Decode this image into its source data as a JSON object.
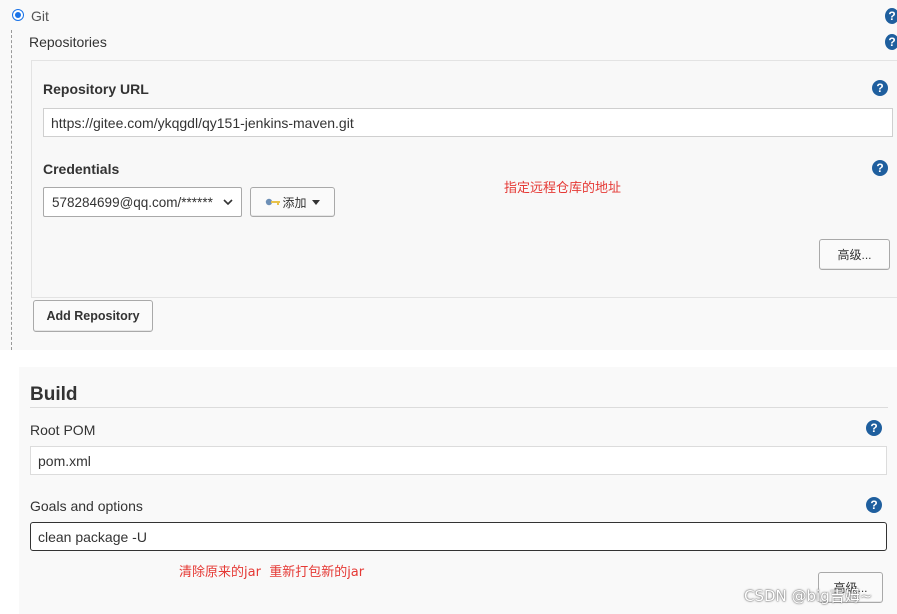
{
  "scm": {
    "option_label": "Git",
    "repositories_label": "Repositories",
    "repository_url_label": "Repository URL",
    "repository_url_value": "https://gitee.com/ykqgdl/qy151-jenkins-maven.git",
    "credentials_label": "Credentials",
    "credentials_value": "578284699@qq.com/******",
    "add_credential_label": "添加",
    "advanced_label": "高级...",
    "add_repository_label": "Add Repository",
    "annotation": "指定远程仓库的地址",
    "help_glyph": "?"
  },
  "build": {
    "title": "Build",
    "root_pom_label": "Root POM",
    "root_pom_value": "pom.xml",
    "goals_label": "Goals and options",
    "goals_value": "clean package -U",
    "annotation": "清除原来的jar  重新打包新的jar",
    "advanced_label": "高级..."
  },
  "watermark": "CSDN @big吉姆~",
  "colors": {
    "help_icon": "#1f5f9e",
    "annotation_red": "#e53935",
    "radio_blue": "#1a73e8",
    "panel_bg": "#f9f9f9"
  },
  "icons": {
    "help": "question-circle-icon",
    "key": "key-icon",
    "caret": "caret-down-icon",
    "chevron": "chevron-down-icon",
    "radio": "radio-selected-icon"
  }
}
